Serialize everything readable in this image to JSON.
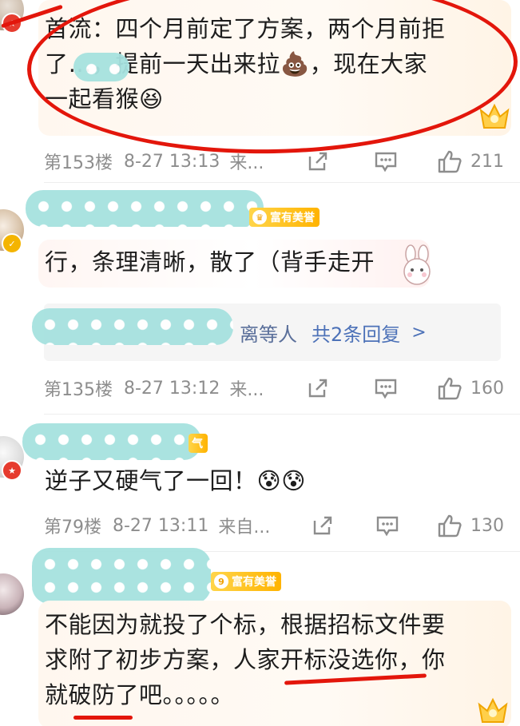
{
  "comments": [
    {
      "text_lines": [
        "首流：四个月前定了方案，两个月前拒",
        "了…，提前一天出来拉💩，现在大家",
        "一起看猴😆"
      ],
      "floor": "第153楼",
      "time": "8-27 13:13",
      "source": "来...",
      "likes": "211"
    },
    {
      "badge": "富有美誉",
      "text_lines": [
        "行，条理清晰，散了（背手走开"
      ],
      "reply_suffix": "离等人",
      "reply_more": "共2条回复",
      "floor": "第135楼",
      "time": "8-27 13:12",
      "source": "来...",
      "likes": "160"
    },
    {
      "badge": "气",
      "text_lines": [
        "逆子又硬气了一回！😰😰"
      ],
      "floor": "第79楼",
      "time": "8-27 13:11",
      "source": "来自...",
      "likes": "130"
    },
    {
      "badge": "富有美誉",
      "badge_level": "9",
      "text_lines": [
        "不能因为就投了个标，根据招标文件要",
        "求附了初步方案，人家开标没选你，你",
        "就破防了吧。。。。。"
      ]
    }
  ],
  "icon_names": [
    "share-icon",
    "comment-icon",
    "like-icon",
    "vip-badge-icon",
    "crest-icon",
    "chevron-right-icon"
  ],
  "colors": {
    "annotation_red": "#e3160b",
    "link_blue": "#4d72b8",
    "meta_gray": "#8d8d8d",
    "badge_gold": "#ffb300"
  }
}
